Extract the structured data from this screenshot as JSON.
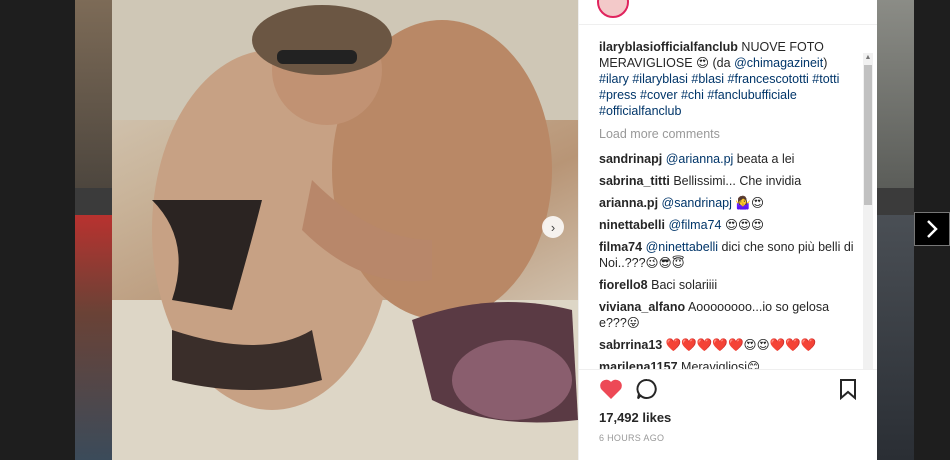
{
  "post": {
    "caption_user": "ilaryblasiofficialfanclub",
    "caption_text": "NUOVE FOTO MERAVIGLIOSE 😍 (da ",
    "caption_mention": "@chimagazineit",
    "caption_close": ")",
    "hashtags": "#ilary #ilaryblasi #blasi #francescototti #totti #press #cover #chi #fanclubufficiale #officialfanclub",
    "load_more": "Load more comments",
    "likes": "17,492 likes",
    "time": "6 HOURS AGO"
  },
  "comments": [
    {
      "user": "sandrinapj",
      "mention": "@arianna.pj",
      "text": " beata a lei"
    },
    {
      "user": "sabrina_titti",
      "mention": "",
      "text": "Bellissimi... Che invidia"
    },
    {
      "user": "arianna.pj",
      "mention": "@sandrinapj",
      "text": " 🤷‍♀️😍"
    },
    {
      "user": "ninettabelli",
      "mention": "@filma74",
      "text": " 😍😍😍"
    },
    {
      "user": "filma74",
      "mention": "@ninettabelli",
      "text": " dici che sono più belli di Noi..???😉😎😇"
    },
    {
      "user": "fiorello8",
      "mention": "",
      "text": "Baci solariiii"
    },
    {
      "user": "viviana_alfano",
      "mention": "",
      "text": "Aoooooooo...io so gelosa e???😛"
    },
    {
      "user": "sabrrina13",
      "mention": "",
      "text": "❤️❤️❤️❤️❤️😍😍❤️❤️❤️"
    },
    {
      "user": "marilena1157",
      "mention": "",
      "text": "Meravigliosi😊"
    }
  ],
  "colors": {
    "heart": "#ed4956",
    "link": "#003569",
    "muted": "#999999"
  },
  "icons": [
    "heart-icon",
    "comment-icon",
    "bookmark-icon",
    "chevron-right-icon",
    "carousel-next-icon"
  ]
}
